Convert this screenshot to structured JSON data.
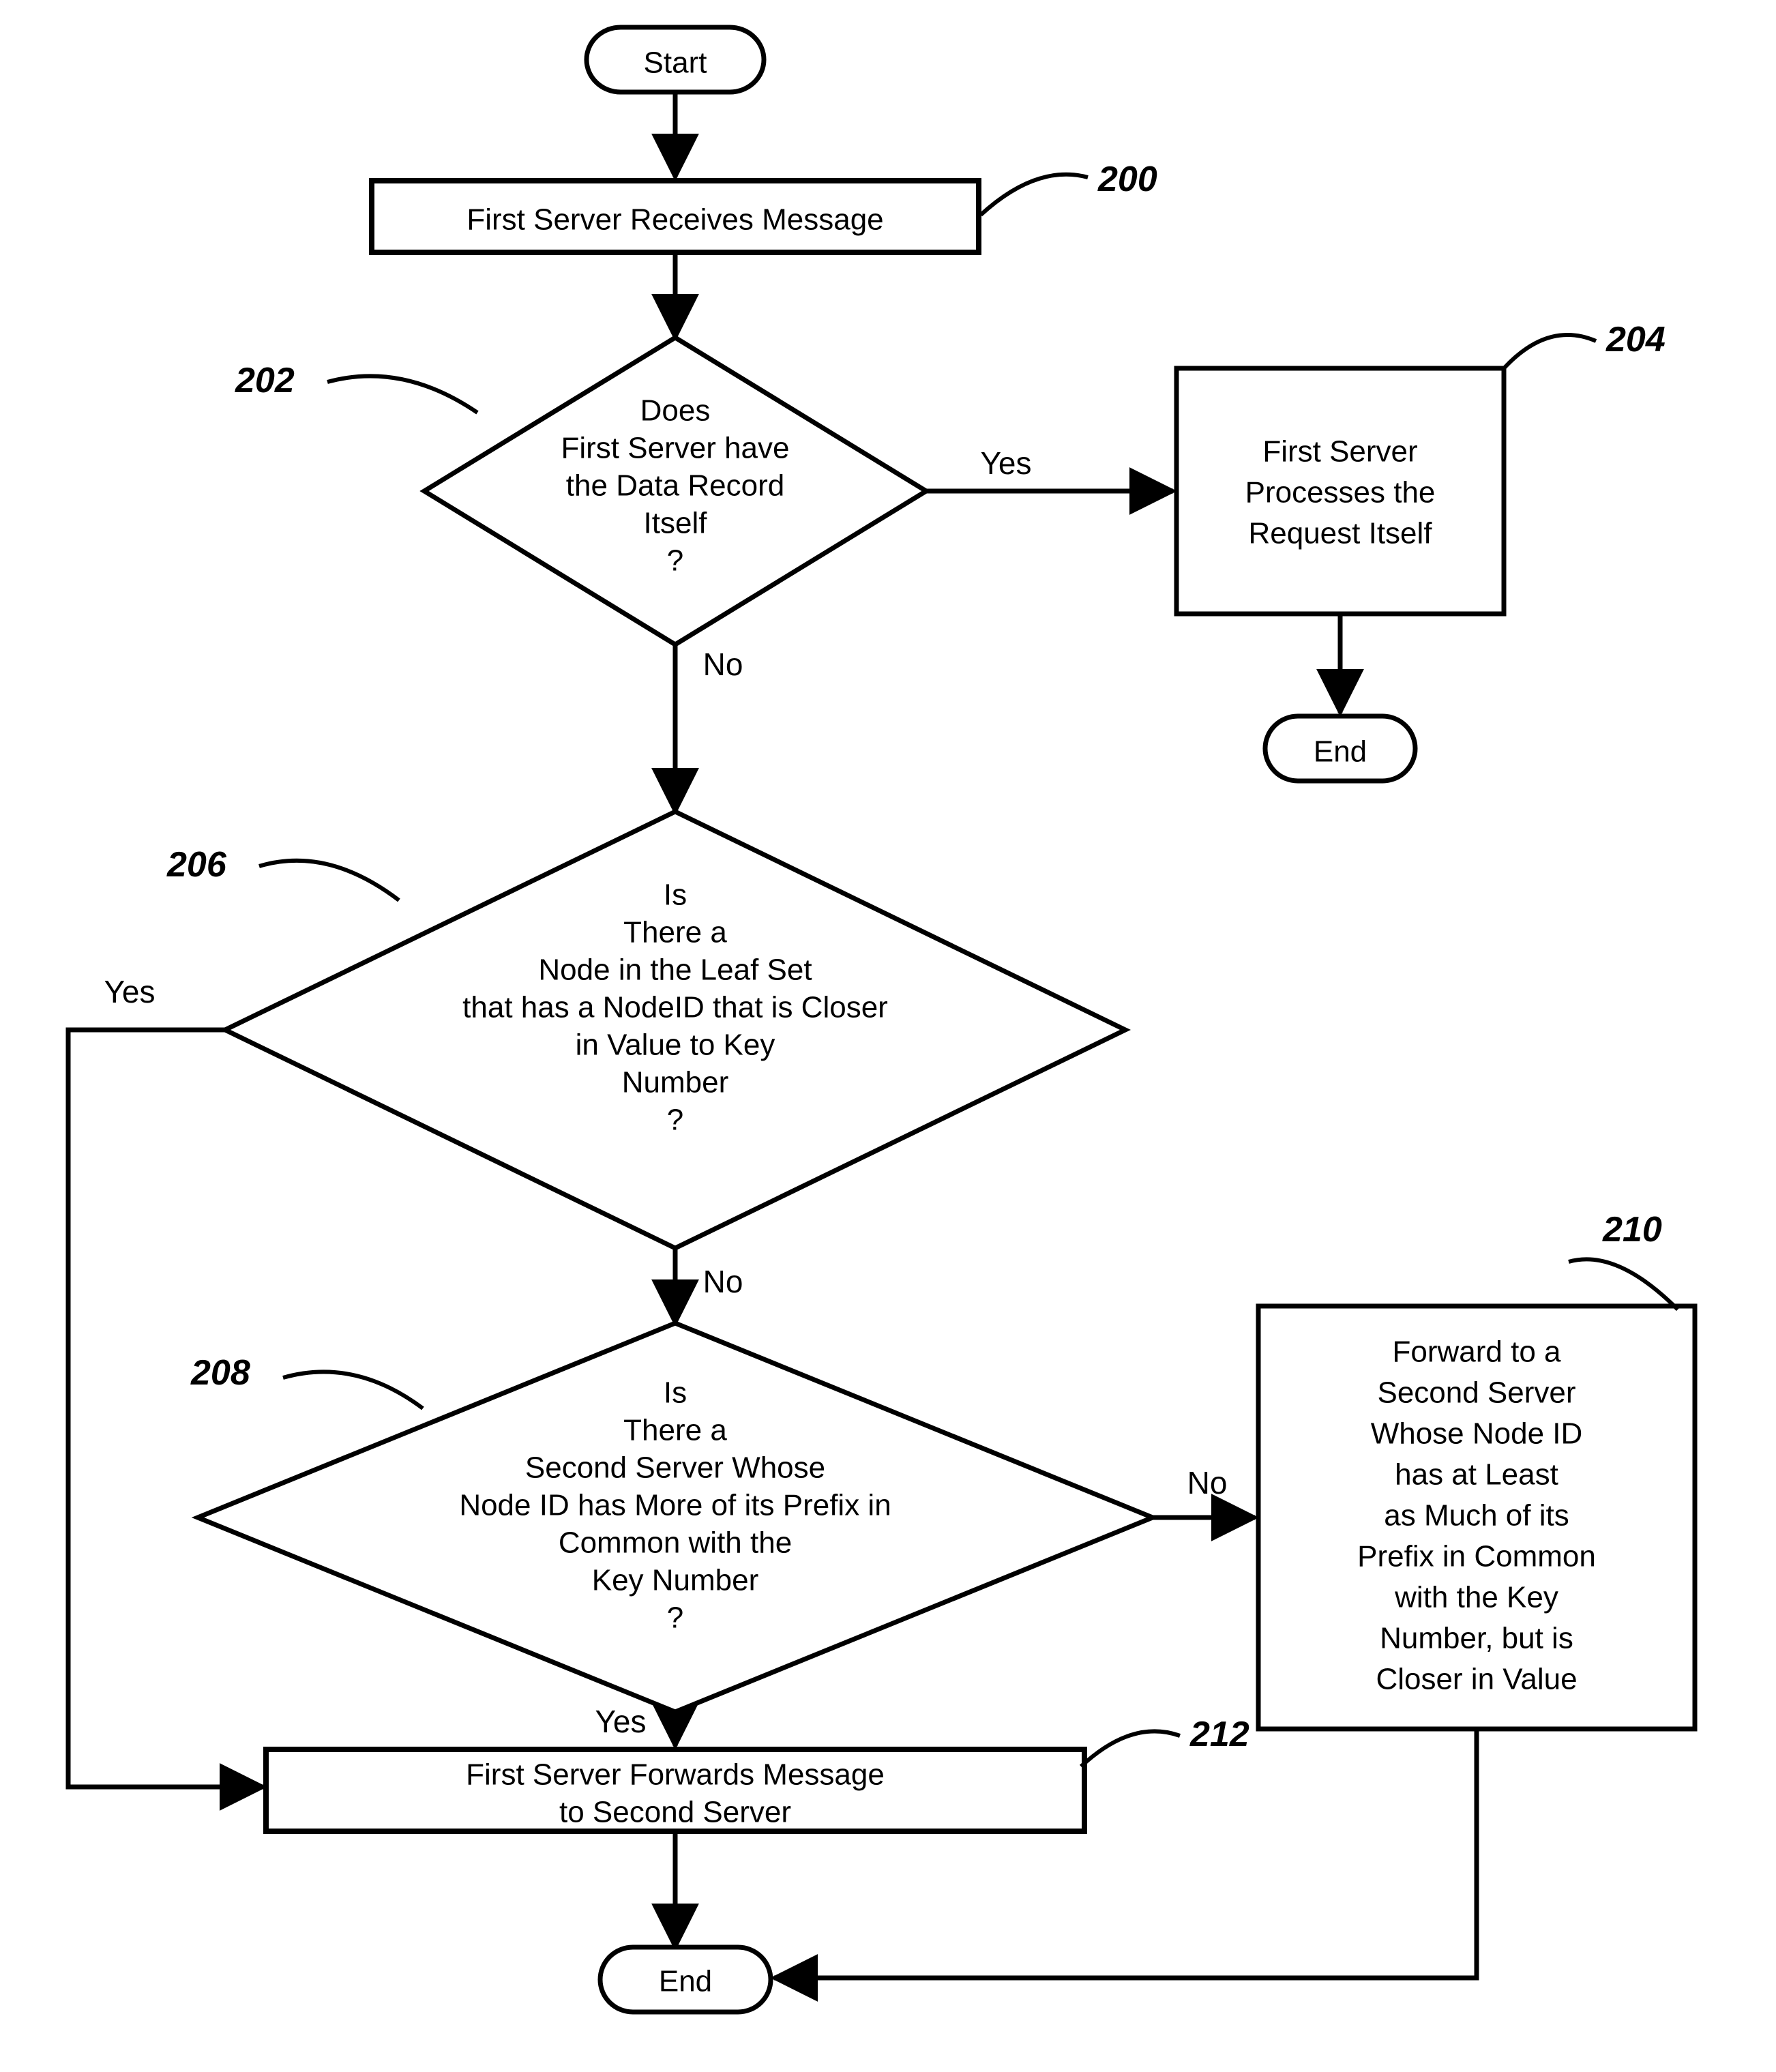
{
  "chart_data": {
    "type": "flowchart",
    "nodes": [
      {
        "id": "start",
        "shape": "terminal",
        "label": "Start"
      },
      {
        "id": "n200",
        "shape": "process",
        "label": "First Server Receives Message",
        "ref": "200"
      },
      {
        "id": "n202",
        "shape": "decision",
        "label": "Does First Server have the Data Record Itself ?",
        "ref": "202"
      },
      {
        "id": "n204",
        "shape": "process",
        "label": "First Server Processes the Request Itself",
        "ref": "204"
      },
      {
        "id": "end1",
        "shape": "terminal",
        "label": "End"
      },
      {
        "id": "n206",
        "shape": "decision",
        "label": "Is There a Node in the Leaf Set that has a NodeID that is Closer in Value to Key Number ?",
        "ref": "206"
      },
      {
        "id": "n208",
        "shape": "decision",
        "label": "Is There a Second Server Whose Node ID has More of its Prefix in Common with the Key Number ?",
        "ref": "208"
      },
      {
        "id": "n210",
        "shape": "process",
        "label": "Forward to a Second Server Whose Node ID has at Least as Much of its Prefix in Common with the Key Number, but is Closer in Value",
        "ref": "210"
      },
      {
        "id": "n212",
        "shape": "process",
        "label": "First Server Forwards Message to Second Server",
        "ref": "212"
      },
      {
        "id": "end2",
        "shape": "terminal",
        "label": "End"
      }
    ],
    "edges": [
      {
        "from": "start",
        "to": "n200"
      },
      {
        "from": "n200",
        "to": "n202"
      },
      {
        "from": "n202",
        "to": "n204",
        "label": "Yes"
      },
      {
        "from": "n202",
        "to": "n206",
        "label": "No"
      },
      {
        "from": "n204",
        "to": "end1"
      },
      {
        "from": "n206",
        "to": "n212",
        "label": "Yes"
      },
      {
        "from": "n206",
        "to": "n208",
        "label": "No"
      },
      {
        "from": "n208",
        "to": "n212",
        "label": "Yes"
      },
      {
        "from": "n208",
        "to": "n210",
        "label": "No"
      },
      {
        "from": "n212",
        "to": "end2"
      },
      {
        "from": "n210",
        "to": "end2"
      }
    ]
  },
  "labels": {
    "start": "Start",
    "end1": "End",
    "end2": "End",
    "yes": "Yes",
    "no": "No",
    "n200_l1": "First Server Receives Message",
    "n202_l1": "Does",
    "n202_l2": "First Server have",
    "n202_l3": "the Data Record",
    "n202_l4": "Itself",
    "n202_l5": "?",
    "n204_l1": "First Server",
    "n204_l2": "Processes the",
    "n204_l3": "Request Itself",
    "n206_l1": "Is",
    "n206_l2": "There a",
    "n206_l3": "Node in the Leaf Set",
    "n206_l4": "that has a NodeID that is Closer",
    "n206_l5": "in Value to Key",
    "n206_l6": "Number",
    "n206_l7": "?",
    "n208_l1": "Is",
    "n208_l2": "There a",
    "n208_l3": "Second Server Whose",
    "n208_l4": "Node ID has More of its Prefix in",
    "n208_l5": "Common with the",
    "n208_l6": "Key Number",
    "n208_l7": "?",
    "n210_l1": "Forward to a",
    "n210_l2": "Second Server",
    "n210_l3": "Whose Node ID",
    "n210_l4": "has at Least",
    "n210_l5": "as Much of its",
    "n210_l6": "Prefix in Common",
    "n210_l7": "with the Key",
    "n210_l8": "Number, but is",
    "n210_l9": "Closer in Value",
    "n212_l1": "First Server Forwards Message",
    "n212_l2": "to Second Server",
    "r200": "200",
    "r202": "202",
    "r204": "204",
    "r206": "206",
    "r208": "208",
    "r210": "210",
    "r212": "212"
  }
}
